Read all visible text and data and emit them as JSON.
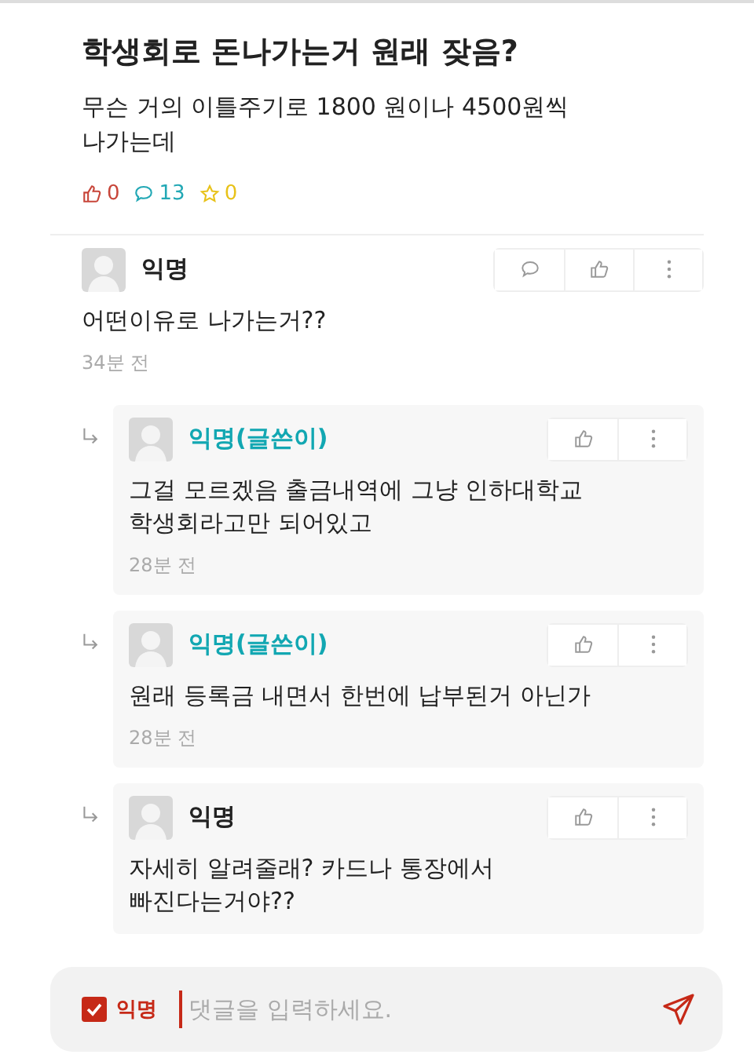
{
  "post": {
    "title": "학생회로 돈나가는거 원래 잦음?",
    "body": "무슨 거의 이틀주기로 1800 원이나 4500원씩\n나가는데",
    "likes": "0",
    "comments": "13",
    "scraps": "0"
  },
  "comments": [
    {
      "kind": "comment",
      "author": "익명",
      "writer": false,
      "text": "어떤이유로 나가는거??",
      "time": "34분 전"
    },
    {
      "kind": "reply",
      "author": "익명(글쓴이)",
      "writer": true,
      "text": "그걸 모르겠음 출금내역에 그냥 인하대학교\n학생회라고만 되어있고",
      "time": "28분 전"
    },
    {
      "kind": "reply",
      "author": "익명(글쓴이)",
      "writer": true,
      "text": "원래 등록금 내면서 한번에 납부된거 아닌가",
      "time": "28분 전"
    },
    {
      "kind": "reply",
      "author": "익명",
      "writer": false,
      "text": "자세히 알려줄래? 카드나 통장에서\n빠진다는거야??"
    }
  ],
  "composer": {
    "anonymous": {
      "label": "익명",
      "checked": true
    },
    "placeholder": "댓글을 입력하세요."
  }
}
